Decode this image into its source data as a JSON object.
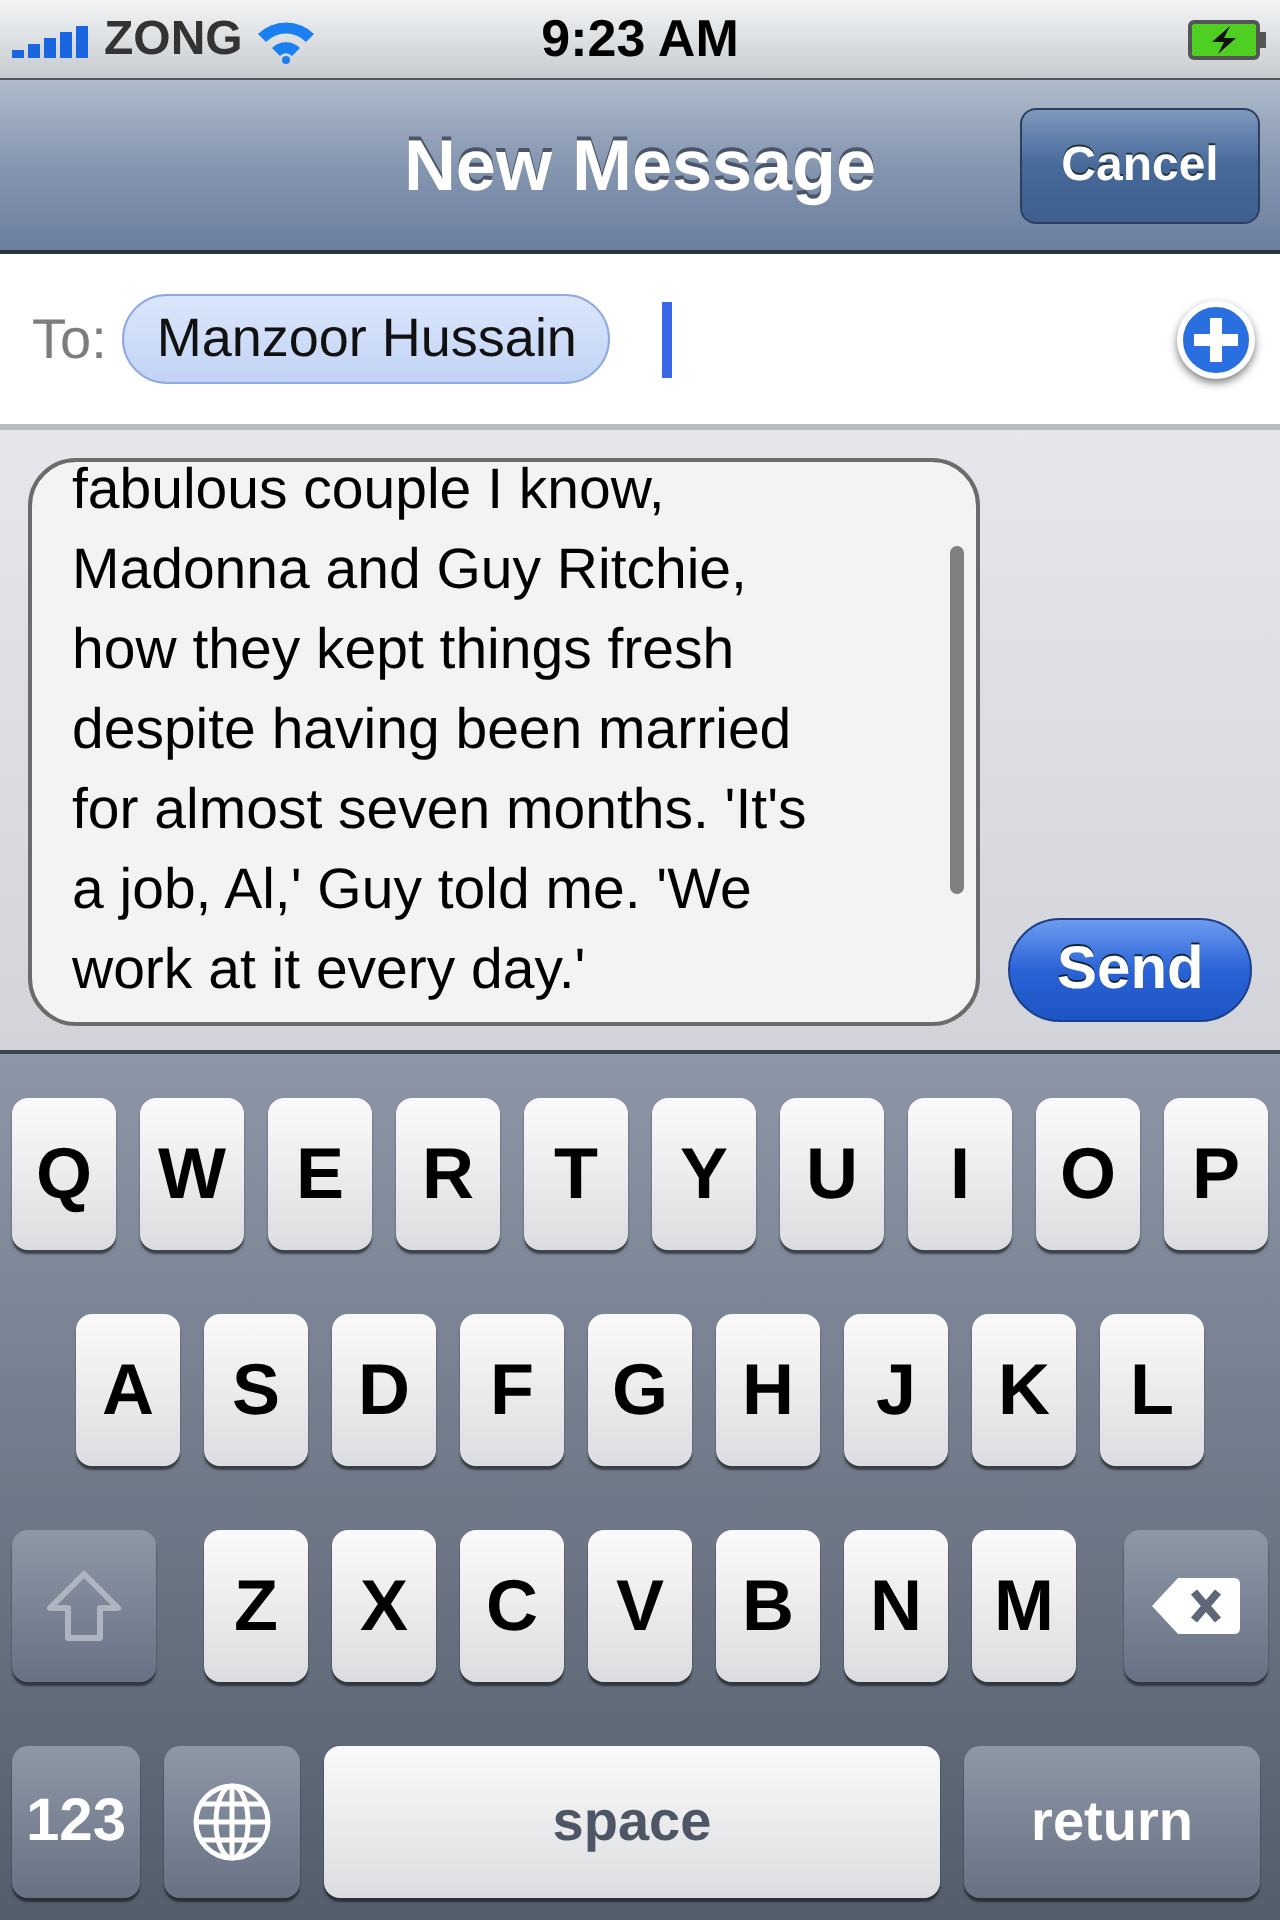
{
  "status_bar": {
    "carrier": "ZONG",
    "time": "9:23 AM"
  },
  "nav_bar": {
    "title": "New Message",
    "cancel_button": "Cancel"
  },
  "to_field": {
    "label": "To:",
    "recipients": [
      "Manzoor Hussain"
    ]
  },
  "message": {
    "text": "fabulous couple I know,\nMadonna and Guy Ritchie,\nhow they kept things fresh\ndespite having been married\nfor almost seven months. 'It's\na job, Al,' Guy told me. 'We\nwork at it every day.'"
  },
  "send_button": "Send",
  "keyboard": [
    [
      {
        "kind": "letter",
        "label": "Q"
      },
      {
        "kind": "letter",
        "label": "W"
      },
      {
        "kind": "letter",
        "label": "E"
      },
      {
        "kind": "letter",
        "label": "R"
      },
      {
        "kind": "letter",
        "label": "T"
      },
      {
        "kind": "letter",
        "label": "Y"
      },
      {
        "kind": "letter",
        "label": "U"
      },
      {
        "kind": "letter",
        "label": "I"
      },
      {
        "kind": "letter",
        "label": "O"
      },
      {
        "kind": "letter",
        "label": "P"
      }
    ],
    [
      {
        "kind": "letter",
        "label": "A"
      },
      {
        "kind": "letter",
        "label": "S"
      },
      {
        "kind": "letter",
        "label": "D"
      },
      {
        "kind": "letter",
        "label": "F"
      },
      {
        "kind": "letter",
        "label": "G"
      },
      {
        "kind": "letter",
        "label": "H"
      },
      {
        "kind": "letter",
        "label": "J"
      },
      {
        "kind": "letter",
        "label": "K"
      },
      {
        "kind": "letter",
        "label": "L"
      }
    ],
    [
      {
        "kind": "shift"
      },
      {
        "kind": "letter",
        "label": "Z"
      },
      {
        "kind": "letter",
        "label": "X"
      },
      {
        "kind": "letter",
        "label": "C"
      },
      {
        "kind": "letter",
        "label": "V"
      },
      {
        "kind": "letter",
        "label": "B"
      },
      {
        "kind": "letter",
        "label": "N"
      },
      {
        "kind": "letter",
        "label": "M"
      },
      {
        "kind": "delete"
      }
    ],
    [
      {
        "kind": "numbers",
        "label": "123"
      },
      {
        "kind": "globe"
      },
      {
        "kind": "space",
        "label": "space"
      },
      {
        "kind": "return",
        "label": "return"
      }
    ]
  ]
}
